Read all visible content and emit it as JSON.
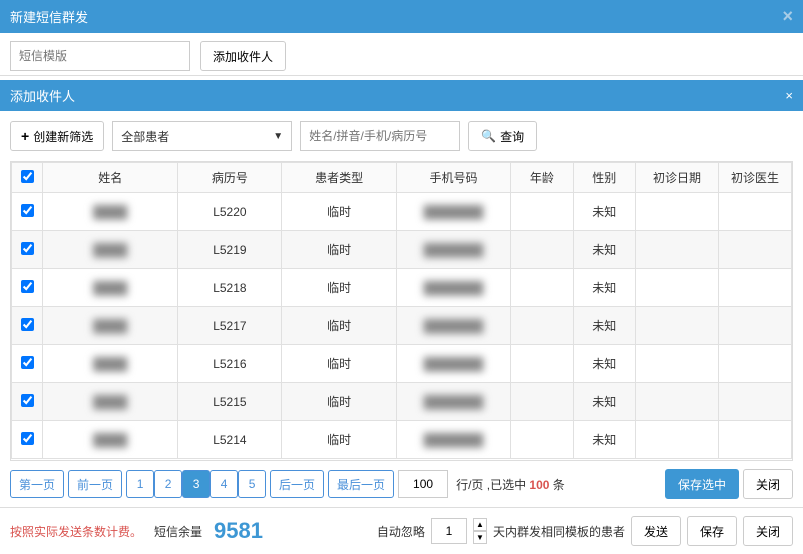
{
  "modal_title": "新建短信群发",
  "template_placeholder": "短信模版",
  "add_recipient_btn": "添加收件人",
  "sub_title": "添加收件人",
  "filter": {
    "new_filter_btn": "创建新筛选",
    "dropdown_value": "全部患者",
    "search_placeholder": "姓名/拼音/手机/病历号",
    "query_btn": "查询"
  },
  "table": {
    "headers": {
      "name": "姓名",
      "record_no": "病历号",
      "patient_type": "患者类型",
      "phone": "手机号码",
      "age": "年龄",
      "gender": "性别",
      "first_visit_date": "初诊日期",
      "first_visit_doctor": "初诊医生"
    },
    "rows": [
      {
        "checked": true,
        "name": "████",
        "record_no": "L5220",
        "patient_type": "临时",
        "phone": "███████",
        "age": "",
        "gender": "未知",
        "date": "",
        "doctor": ""
      },
      {
        "checked": true,
        "name": "████",
        "record_no": "L5219",
        "patient_type": "临时",
        "phone": "███████",
        "age": "",
        "gender": "未知",
        "date": "",
        "doctor": ""
      },
      {
        "checked": true,
        "name": "████",
        "record_no": "L5218",
        "patient_type": "临时",
        "phone": "███████",
        "age": "",
        "gender": "未知",
        "date": "",
        "doctor": ""
      },
      {
        "checked": true,
        "name": "████",
        "record_no": "L5217",
        "patient_type": "临时",
        "phone": "███████",
        "age": "",
        "gender": "未知",
        "date": "",
        "doctor": ""
      },
      {
        "checked": true,
        "name": "████",
        "record_no": "L5216",
        "patient_type": "临时",
        "phone": "███████",
        "age": "",
        "gender": "未知",
        "date": "",
        "doctor": ""
      },
      {
        "checked": true,
        "name": "████",
        "record_no": "L5215",
        "patient_type": "临时",
        "phone": "███████",
        "age": "",
        "gender": "未知",
        "date": "",
        "doctor": ""
      },
      {
        "checked": true,
        "name": "████",
        "record_no": "L5214",
        "patient_type": "临时",
        "phone": "███████",
        "age": "",
        "gender": "未知",
        "date": "",
        "doctor": ""
      }
    ]
  },
  "pagination": {
    "first": "第一页",
    "prev": "前一页",
    "pages": [
      "1",
      "2",
      "3",
      "4",
      "5"
    ],
    "active_page": "3",
    "next": "后一页",
    "last": "最后一页",
    "rows_per_page": "100",
    "rows_label_prefix": "行/页 ,已选中 ",
    "selected_count": "100",
    "rows_label_suffix": " 条",
    "save_selected": "保存选中",
    "close": "关闭"
  },
  "footer": {
    "charge_note": "按照实际发送条数计费。",
    "balance_label": "短信余量",
    "balance": "9581",
    "auto_ignore_label": "自动忽略",
    "days": "1",
    "days_suffix": "天内群发相同模板的患者",
    "send": "发送",
    "save": "保存",
    "close": "关闭"
  }
}
